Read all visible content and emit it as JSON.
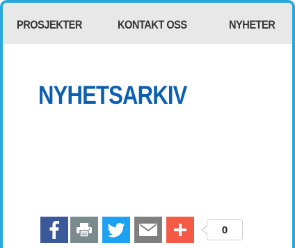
{
  "nav": {
    "items": [
      {
        "label": "PROSJEKTER"
      },
      {
        "label": "KONTAKT OSS"
      },
      {
        "label": "NYHETER"
      }
    ]
  },
  "page": {
    "title": "NYHETSARKIV"
  },
  "share": {
    "buttons": [
      {
        "icon": "facebook-icon",
        "color": "#3b5998"
      },
      {
        "icon": "print-icon",
        "color": "#7a8a8d"
      },
      {
        "icon": "twitter-icon",
        "color": "#1da1f2"
      },
      {
        "icon": "email-icon",
        "color": "#7f7f7f"
      },
      {
        "icon": "plus-icon",
        "color": "#f45a45"
      }
    ],
    "count": "0"
  },
  "colors": {
    "accent_border": "#29a8df",
    "title": "#0c5fb0",
    "nav_background": "#e8e8e8"
  }
}
